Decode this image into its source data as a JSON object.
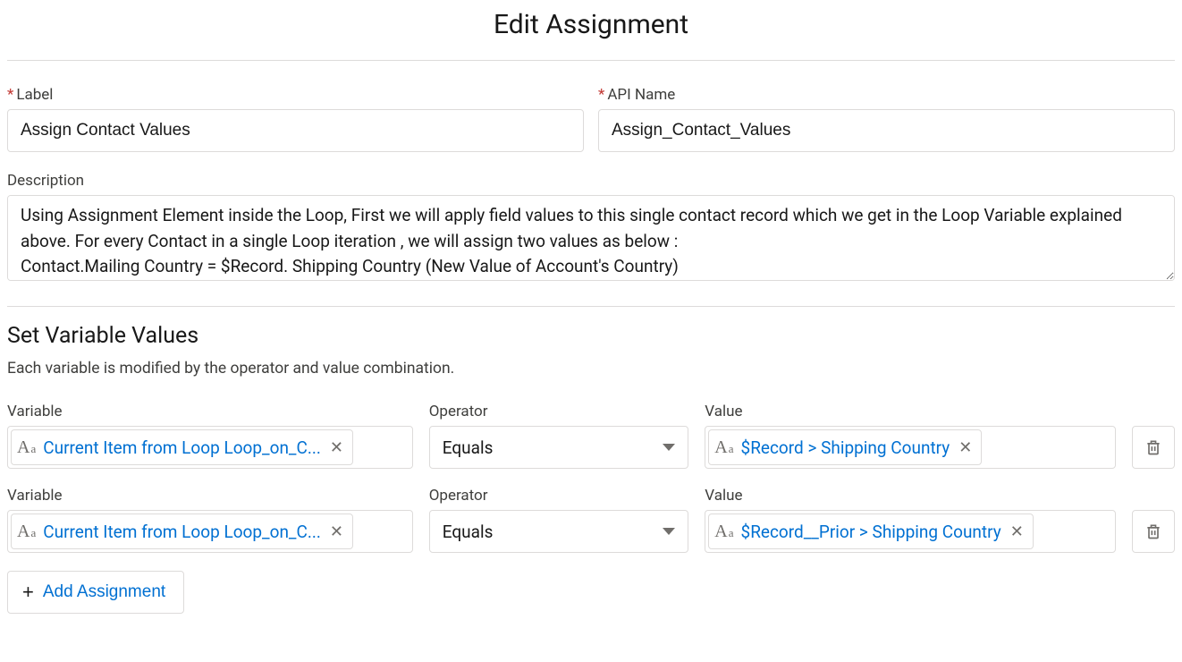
{
  "title": "Edit Assignment",
  "fields": {
    "label": {
      "label": "Label",
      "value": "Assign Contact Values",
      "required": true
    },
    "api_name": {
      "label": "API Name",
      "value": "Assign_Contact_Values",
      "required": true
    },
    "description": {
      "label": "Description",
      "value": "Using Assignment Element inside the Loop, First we will apply field values to this single contact record which we get in the Loop Variable explained above. For every Contact in a single Loop iteration , we will assign two values as below :\nContact.Mailing Country = $Record. Shipping Country (New Value of Account's Country)"
    }
  },
  "section": {
    "heading": "Set Variable Values",
    "subtext": "Each variable is modified by the operator and value combination."
  },
  "columns": {
    "variable": "Variable",
    "operator": "Operator",
    "value": "Value"
  },
  "rows": [
    {
      "variable": "Current Item from Loop Loop_on_C...",
      "operator": "Equals",
      "value": "$Record > Shipping Country"
    },
    {
      "variable": "Current Item from Loop Loop_on_C...",
      "operator": "Equals",
      "value": "$Record__Prior > Shipping Country"
    }
  ],
  "add_button": "Add Assignment",
  "icons": {
    "text_type": "Aa",
    "remove": "✕",
    "plus": "+"
  }
}
